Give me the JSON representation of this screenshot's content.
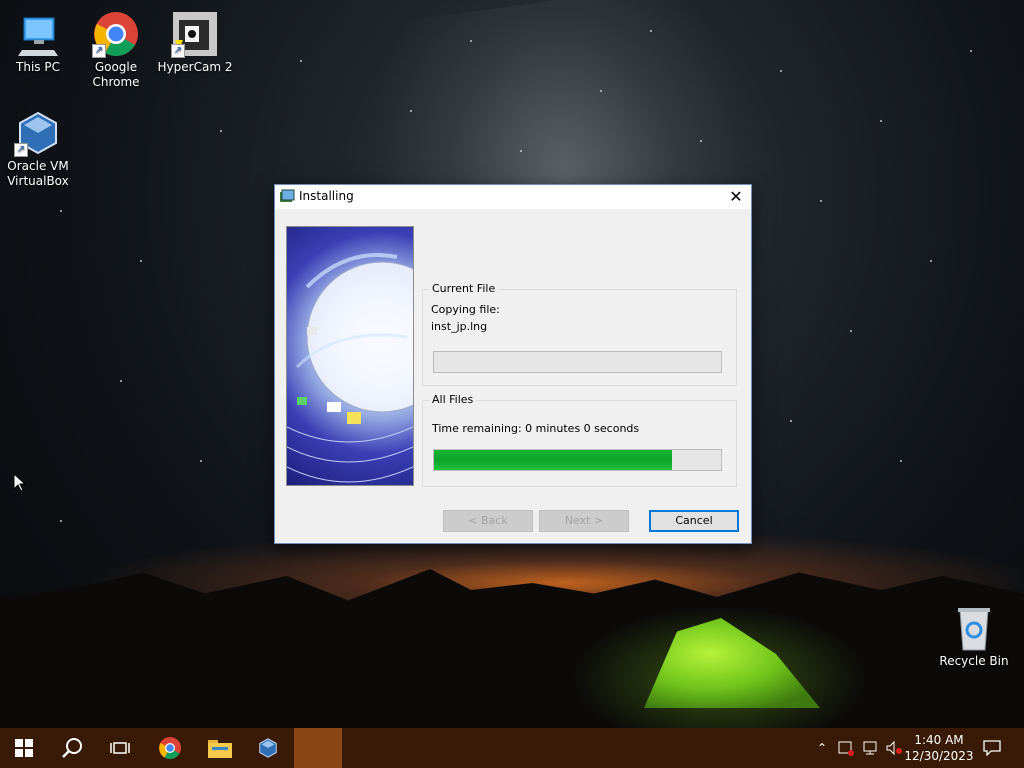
{
  "desktop": {
    "icons": [
      {
        "label": "This PC"
      },
      {
        "label": "Google Chrome"
      },
      {
        "label": "HyperCam 2"
      },
      {
        "label": "Oracle VM VirtualBox"
      },
      {
        "label": "Recycle Bin"
      }
    ]
  },
  "dialog": {
    "title": "Installing",
    "close_glyph": "✕",
    "current_file": {
      "group_label": "Current File",
      "line1": "Copying file:",
      "line2": "inst_jp.lng",
      "progress": 0
    },
    "all_files": {
      "group_label": "All Files",
      "time_remaining": "Time remaining: 0 minutes 0 seconds",
      "progress": 0.83
    },
    "buttons": {
      "back": "< Back",
      "next": "Next >",
      "cancel": "Cancel"
    }
  },
  "taskbar": {
    "clock_time": "1:40 AM",
    "clock_date": "12/30/2023",
    "accent": "#391a06",
    "active_color": "#8a4514"
  }
}
